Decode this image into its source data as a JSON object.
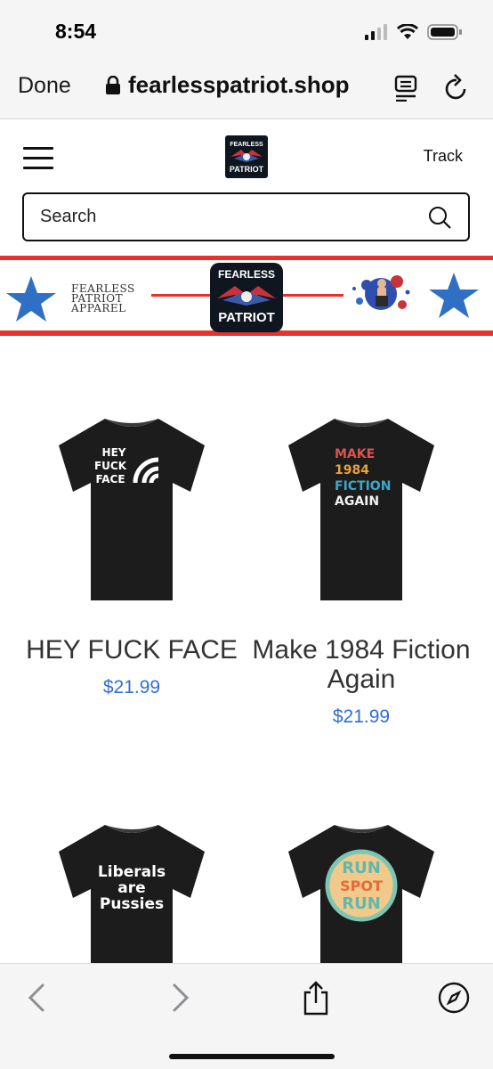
{
  "status_bar": {
    "time": "8:54"
  },
  "browser": {
    "done_label": "Done",
    "url": "fearlesspatriot.shop"
  },
  "header": {
    "track_label": "Track",
    "search_placeholder": "Search",
    "logo_text": {
      "line1": "FEARLESS",
      "line2": "PATRIOT"
    }
  },
  "banner": {
    "text_lines": [
      "FEARLESS",
      "PATRIOT",
      "APPAREL"
    ],
    "logo_text": {
      "line1": "FEARLESS",
      "line2": "PATRIOT"
    }
  },
  "products": [
    {
      "title": "HEY FUCK FACE",
      "price": "$21.99",
      "shirt_text": [
        "HEY",
        "FUCK",
        "FACE"
      ]
    },
    {
      "title": "Make 1984 Fiction Again",
      "price": "$21.99",
      "shirt_text": [
        "MAKE",
        "1984",
        "FICTION",
        "AGAIN"
      ]
    },
    {
      "title": "",
      "price": "",
      "shirt_text": [
        "Liberals",
        "are",
        "Pussies"
      ]
    },
    {
      "title": "",
      "price": "",
      "shirt_text": [
        "RUN",
        "SPOT",
        "RUN"
      ]
    }
  ],
  "colors": {
    "accent_red": "#e8312d",
    "star_blue": "#2f6fc4",
    "price_blue": "#2f6fd6"
  }
}
